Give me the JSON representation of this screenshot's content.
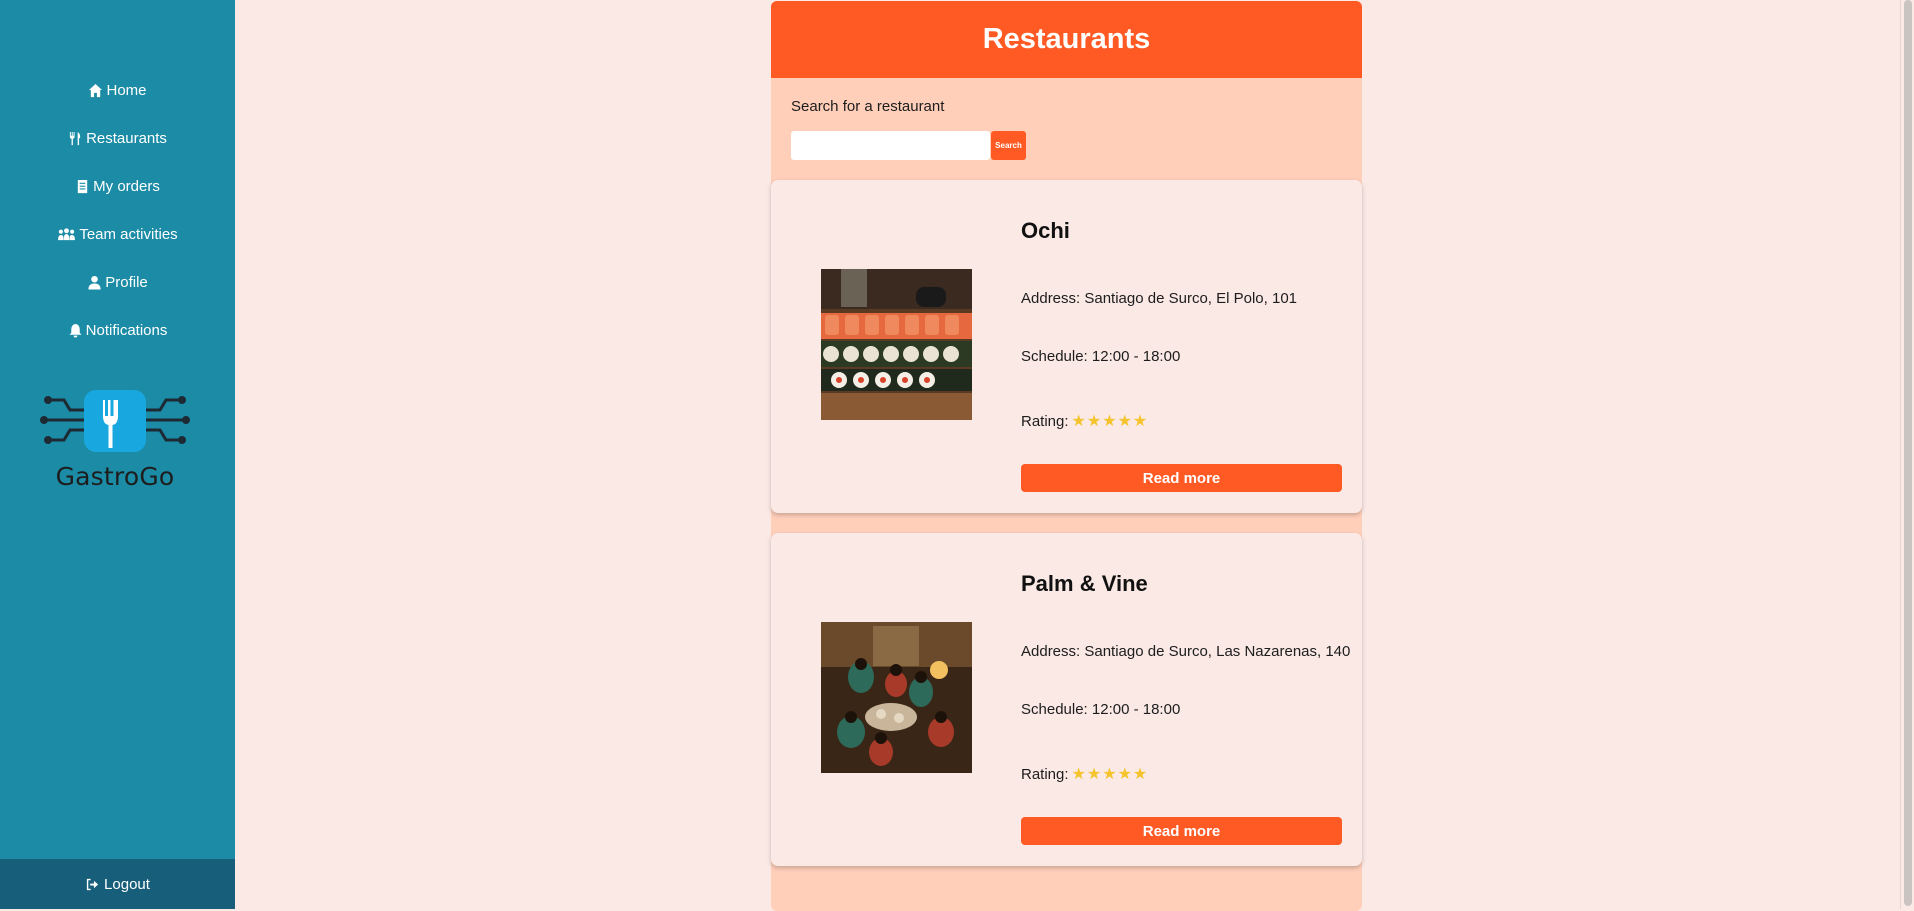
{
  "sidebar": {
    "items": [
      {
        "label": "Home",
        "icon": "home-icon"
      },
      {
        "label": "Restaurants",
        "icon": "utensils-icon"
      },
      {
        "label": "My orders",
        "icon": "receipt-icon"
      },
      {
        "label": "Team activities",
        "icon": "team-icon"
      },
      {
        "label": "Profile",
        "icon": "user-icon"
      },
      {
        "label": "Notifications",
        "icon": "bell-icon"
      }
    ],
    "logo_text": "GastroGo",
    "logout_label": "Logout"
  },
  "main": {
    "title": "Restaurants",
    "search": {
      "label": "Search for a restaurant",
      "value": "",
      "placeholder": "",
      "button_label": "Search"
    },
    "restaurants": [
      {
        "name": "Ochi",
        "address": "Address: Santiago de Surco, El Polo, 101",
        "schedule": "Schedule: 12:00 - 18:00",
        "rating_label": "Rating:",
        "rating": 5,
        "rating_stars": "★★★★★",
        "button_label": "Read more"
      },
      {
        "name": "Palm & Vine",
        "address": "Address: Santiago de Surco, Las Nazarenas, 140",
        "schedule": "Schedule: 12:00 - 18:00",
        "rating_label": "Rating:",
        "rating": 5,
        "rating_stars": "★★★★★",
        "button_label": "Read more"
      }
    ]
  },
  "colors": {
    "sidebar": "#1b8ba6",
    "logout_bar": "#175e7a",
    "accent": "#ff5a24",
    "panel": "#ffcfba",
    "card": "#fae9e5",
    "page_bg": "#fbe9e6",
    "star": "#f5c42c"
  }
}
